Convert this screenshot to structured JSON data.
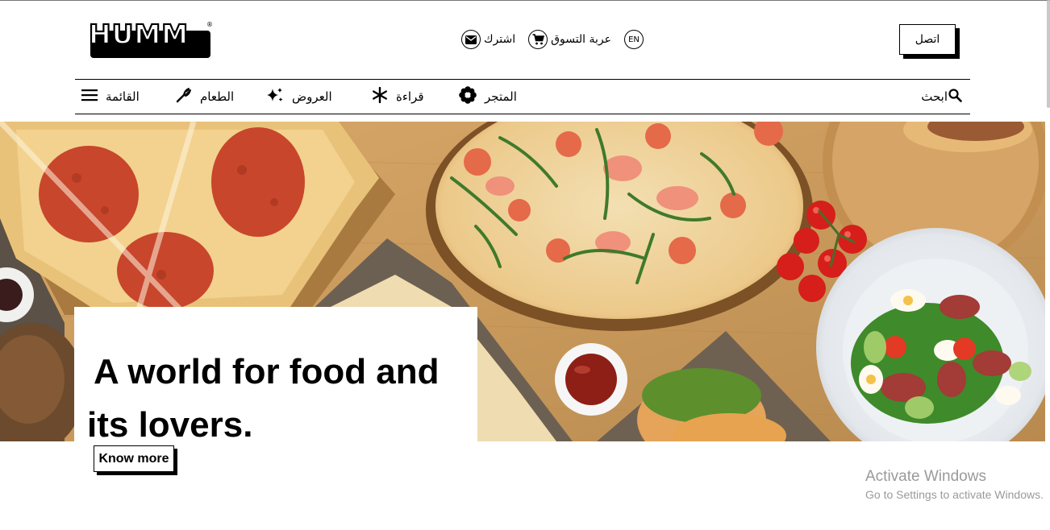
{
  "header": {
    "logo_text": "HUMM",
    "logo_reg": "®",
    "language": "EN",
    "cart_label": "عربة التسوق",
    "subscribe_label": "اشترك",
    "connect_label": "اتصل"
  },
  "nav": {
    "menu_label": "القائمة",
    "food_label": "الطعام",
    "offers_label": "العروض",
    "reading_label": "قراءة",
    "store_label": "المتجر",
    "search_label": "ابحث"
  },
  "hero": {
    "title_line1": "A world for food and",
    "title_line2": "its lovers.",
    "button_label": "Know more"
  },
  "os_watermark": {
    "line1": "Activate Windows",
    "line2": "Go to Settings to activate Windows."
  },
  "icons": {
    "menu": "hamburger-icon",
    "food": "fork-icon",
    "offers": "sparkle-icon",
    "reading": "asterisk-icon",
    "store": "flower-icon",
    "search": "search-icon",
    "cart": "cart-icon",
    "subscribe": "mail-icon"
  }
}
